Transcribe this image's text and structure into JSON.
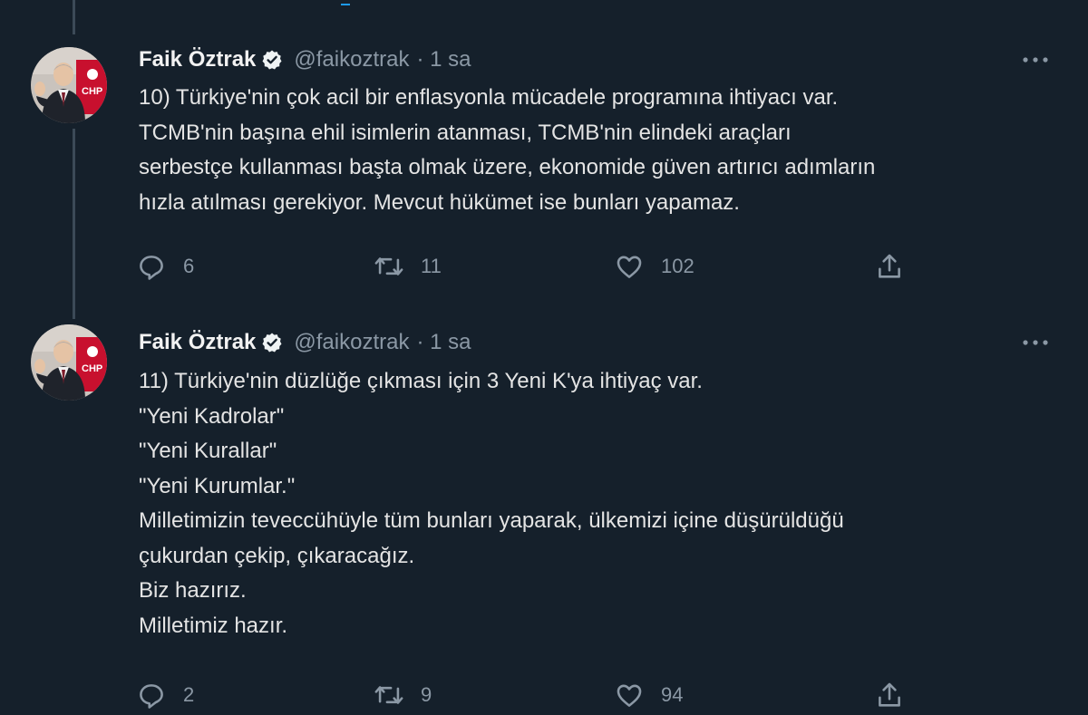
{
  "tweets": [
    {
      "author": {
        "name": "Faik Öztrak",
        "handle": "@faikoztrak",
        "time": "· 1 sa",
        "avatar_badge": "CHP"
      },
      "text_lines": [
        "10) Türkiye'nin çok acil bir enflasyonla mücadele programına ihtiyacı var.",
        "TCMB'nin başına ehil isimlerin atanması, TCMB'nin elindeki araçları",
        "serbestçe kullanması başta olmak üzere, ekonomide güven artırıcı adımların",
        "hızla atılması gerekiyor. Mevcut hükümet ise bunları yapamaz."
      ],
      "stats": {
        "replies": "6",
        "retweets": "11",
        "likes": "102"
      }
    },
    {
      "author": {
        "name": "Faik Öztrak",
        "handle": "@faikoztrak",
        "time": "· 1 sa",
        "avatar_badge": "CHP"
      },
      "text_lines": [
        "11) Türkiye'nin düzlüğe çıkması için 3 Yeni K'ya ihtiyaç var.",
        "\"Yeni Kadrolar\"",
        "\"Yeni Kurallar\"",
        "\"Yeni Kurumlar.\"",
        "Milletimizin teveccühüyle tüm bunları yaparak, ülkemizi içine düşürüldüğü",
        "çukurdan çekip, çıkaracağız.",
        "Biz hazırız.",
        "Milletimiz hazır."
      ],
      "stats": {
        "replies": "2",
        "retweets": "9",
        "likes": "94"
      }
    }
  ],
  "icons": {
    "verified": "verified-badge-icon",
    "more": "more-options-icon",
    "reply": "reply-icon",
    "retweet": "retweet-icon",
    "like": "like-icon",
    "share": "share-icon"
  },
  "colors": {
    "background": "#15202b",
    "text": "#e4e4e4",
    "secondary": "#8b98a5",
    "thread_line": "#3c4a57",
    "accent": "#1d9bf0"
  }
}
